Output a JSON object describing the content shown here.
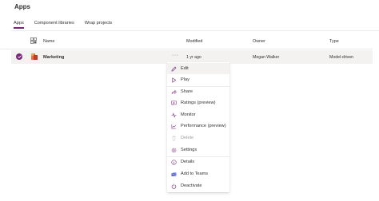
{
  "page": {
    "title": "Apps"
  },
  "tabs": [
    {
      "label": "Apps",
      "active": true
    },
    {
      "label": "Component libraries",
      "active": false
    },
    {
      "label": "Wrap projects",
      "active": false
    }
  ],
  "table": {
    "columns": {
      "type_icon": "app-type-icon",
      "name": "Name",
      "modified": "Modified",
      "owner": "Owner",
      "type": "Type"
    },
    "rows": [
      {
        "name": "Marketing",
        "more": "···",
        "modified": "1 yr ago",
        "owner": "Megan Walker",
        "type": "Model-driven",
        "selected": true
      }
    ]
  },
  "context_menu": {
    "items": [
      {
        "label": "Edit",
        "icon": "pencil-icon"
      },
      {
        "label": "Play",
        "icon": "play-icon"
      },
      {
        "label": "Share",
        "icon": "share-icon"
      },
      {
        "label": "Ratings (preview)",
        "icon": "ratings-icon"
      },
      {
        "label": "Monitor",
        "icon": "monitor-icon"
      },
      {
        "label": "Performance (preview)",
        "icon": "performance-icon"
      },
      {
        "label": "Delete",
        "icon": "trash-icon",
        "disabled": true
      },
      {
        "label": "Settings",
        "icon": "gear-icon"
      },
      {
        "label": "Details",
        "icon": "info-icon"
      },
      {
        "label": "Add to Teams",
        "icon": "teams-icon"
      },
      {
        "label": "Deactivate",
        "icon": "power-icon"
      }
    ]
  },
  "colors": {
    "accent": "#742774",
    "icon_purple": "#742774",
    "row_selected": "#f3f2f1",
    "text": "#323130"
  }
}
